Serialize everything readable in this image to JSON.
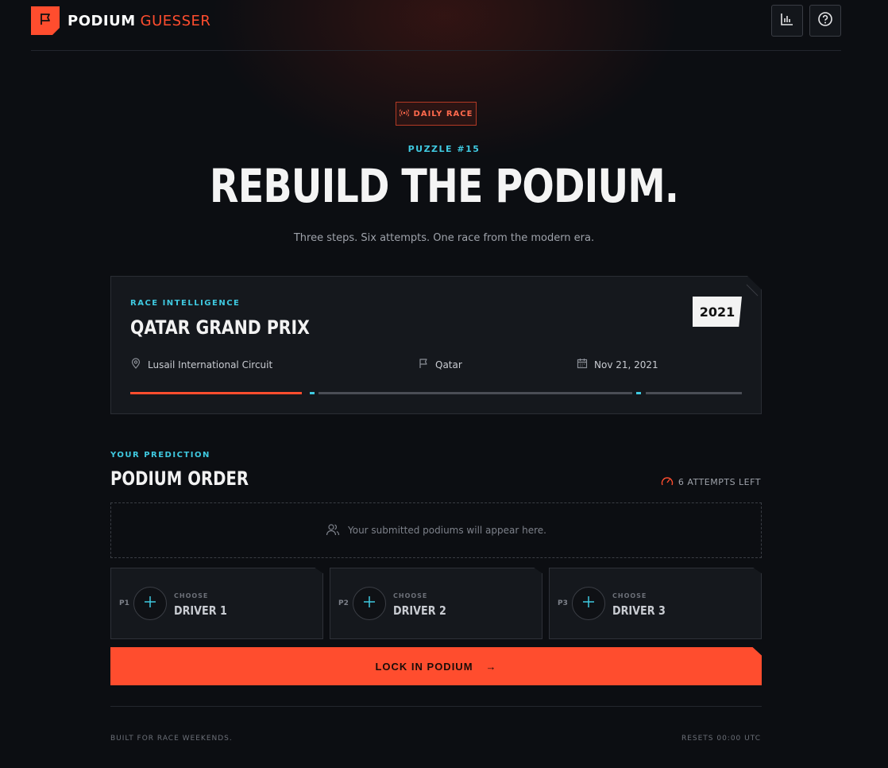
{
  "header": {
    "brand_primary": "PODIUM",
    "brand_secondary": "GUESSER",
    "icons": [
      "flag-icon",
      "bar-chart-icon",
      "help-icon"
    ]
  },
  "hero": {
    "badge": "DAILY RACE",
    "puzzle": "PUZZLE #15",
    "headline": "REBUILD THE PODIUM.",
    "subtitle": "Three steps. Six attempts. One race from the modern era."
  },
  "race": {
    "section_label": "RACE INTELLIGENCE",
    "name": "QATAR GRAND PRIX",
    "year": "2021",
    "circuit": "Lusail International Circuit",
    "country": "Qatar",
    "date": "Nov 21, 2021",
    "progress_fraction": 0.28
  },
  "prediction": {
    "section_label": "YOUR PREDICTION",
    "title": "PODIUM ORDER",
    "attempts": "6 ATTEMPTS LEFT",
    "empty_message": "Your submitted podiums will appear here.",
    "slots": [
      {
        "pos": "P1",
        "choose": "CHOOSE",
        "label": "DRIVER 1"
      },
      {
        "pos": "P2",
        "choose": "CHOOSE",
        "label": "DRIVER 2"
      },
      {
        "pos": "P3",
        "choose": "CHOOSE",
        "label": "DRIVER 3"
      }
    ],
    "submit": "LOCK IN PODIUM",
    "submit_arrow": "→"
  },
  "footer": {
    "left": "BUILT FOR RACE WEEKENDS.",
    "right": "RESETS 00:00 UTC"
  },
  "colors": {
    "accent": "#ff4d2e",
    "cyan": "#3fc9e0",
    "background": "#0c0e12"
  }
}
